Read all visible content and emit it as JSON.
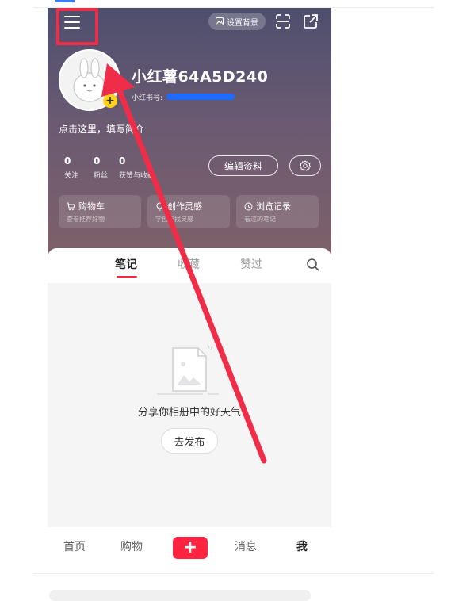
{
  "header": {
    "set_background_label": "设置背景",
    "username": "小红薯64A5D240",
    "redbook_id_label": "小红书号:",
    "bio_placeholder": "点击这里，填写简介",
    "stats": [
      {
        "value": "0",
        "label": "关注"
      },
      {
        "value": "0",
        "label": "粉丝"
      },
      {
        "value": "0",
        "label": "获赞与收藏"
      }
    ],
    "edit_profile_label": "编辑资料",
    "quick_actions": [
      {
        "title": "购物车",
        "subtitle": "查看推荐好物",
        "icon": "cart-icon"
      },
      {
        "title": "创作灵感",
        "subtitle": "学创作找灵感",
        "icon": "bulb-icon"
      },
      {
        "title": "浏览记录",
        "subtitle": "看过的笔记",
        "icon": "clock-icon"
      }
    ]
  },
  "content": {
    "tabs": [
      "笔记",
      "收藏",
      "赞过"
    ],
    "active_tab": "笔记",
    "empty_text": "分享你相册中的好天气",
    "publish_label": "去发布"
  },
  "bottom_nav": {
    "items": [
      "首页",
      "购物",
      "消息",
      "我"
    ],
    "active": "我"
  },
  "colors": {
    "accent": "#ff2442",
    "annotation": "#f02d48",
    "redaction": "#1f6bff"
  }
}
